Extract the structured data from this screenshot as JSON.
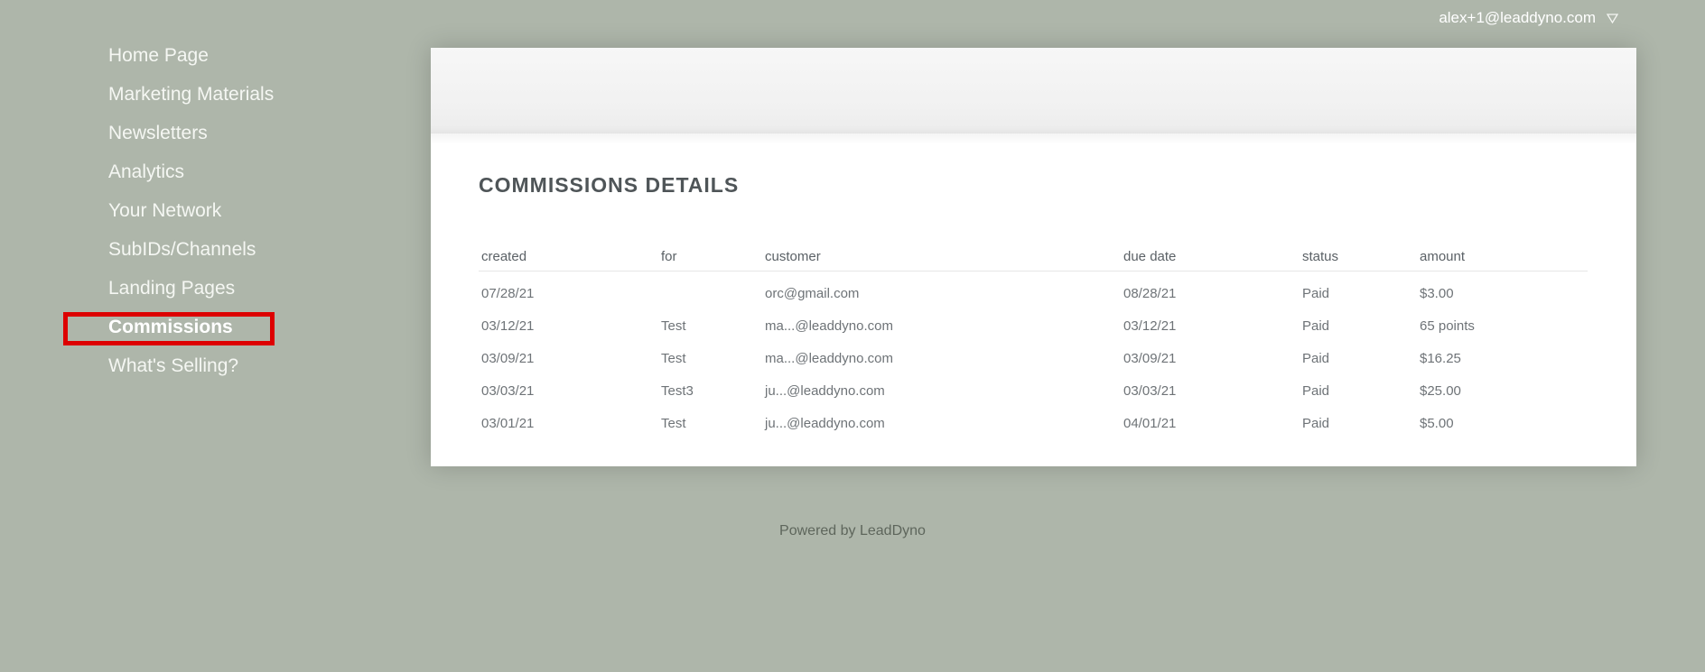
{
  "header": {
    "user_email": "alex+1@leaddyno.com",
    "user_menu_icon": "caret-down-icon"
  },
  "sidebar": {
    "items": [
      {
        "label": "Home Page",
        "active": false
      },
      {
        "label": "Marketing Materials",
        "active": false
      },
      {
        "label": "Newsletters",
        "active": false
      },
      {
        "label": "Analytics",
        "active": false
      },
      {
        "label": "Your Network",
        "active": false
      },
      {
        "label": "SubIDs/Channels",
        "active": false
      },
      {
        "label": "Landing Pages",
        "active": false
      },
      {
        "label": "Commissions",
        "active": true
      },
      {
        "label": "What's Selling?",
        "active": false
      }
    ]
  },
  "main": {
    "title": "COMMISSIONS DETAILS",
    "table": {
      "columns": [
        "created",
        "for",
        "customer",
        "due date",
        "status",
        "amount"
      ],
      "rows": [
        [
          "07/28/21",
          "",
          "orc@gmail.com",
          "08/28/21",
          "Paid",
          "$3.00"
        ],
        [
          "03/12/21",
          "Test",
          "ma...@leaddyno.com",
          "03/12/21",
          "Paid",
          "65 points"
        ],
        [
          "03/09/21",
          "Test",
          "ma...@leaddyno.com",
          "03/09/21",
          "Paid",
          "$16.25"
        ],
        [
          "03/03/21",
          "Test3",
          "ju...@leaddyno.com",
          "03/03/21",
          "Paid",
          "$25.00"
        ],
        [
          "03/01/21",
          "Test",
          "ju...@leaddyno.com",
          "04/01/21",
          "Paid",
          "$5.00"
        ]
      ]
    }
  },
  "footer": {
    "text": "Powered by LeadDyno"
  },
  "colors": {
    "background": "#aeb6aa",
    "highlight": "#dd0000",
    "card": "#ffffff"
  }
}
